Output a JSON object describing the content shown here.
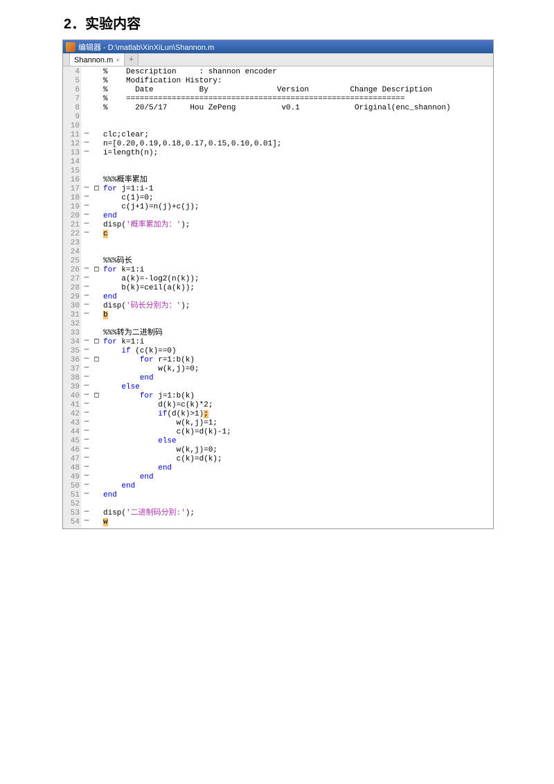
{
  "heading": "2．实验内容",
  "titlebar": "编辑器 - D:\\matlab\\XinXiLun\\Shannon.m",
  "tab": {
    "label": "Shannon.m",
    "close": "×",
    "plus": "+"
  },
  "rows": [
    {
      "n": "4",
      "d": "",
      "f": "",
      "code": "%    Description     : shannon encoder",
      "cls": "c-comment"
    },
    {
      "n": "5",
      "d": "",
      "f": "",
      "code": "%    Modification History:",
      "cls": "c-comment"
    },
    {
      "n": "6",
      "d": "",
      "f": "",
      "code": "%      Date          By               Version         Change Description",
      "cls": "c-comment"
    },
    {
      "n": "7",
      "d": "",
      "f": "",
      "code": "%    =============================================================",
      "cls": "c-comment"
    },
    {
      "n": "8",
      "d": "",
      "f": "",
      "code": "%      20/5/17     Hou ZePeng          v0.1            Original(enc_shannon)",
      "cls": "c-comment"
    },
    {
      "n": "9",
      "d": "",
      "f": "",
      "code": ""
    },
    {
      "n": "10",
      "d": "",
      "f": "",
      "code": ""
    },
    {
      "n": "11",
      "d": "—",
      "f": "",
      "code": "clc;clear;"
    },
    {
      "n": "12",
      "d": "—",
      "f": "",
      "code": "n=[0.20,0.19,0.18,0.17,0.15,0.10,0.01];"
    },
    {
      "n": "13",
      "d": "—",
      "f": "",
      "code": "i=length(n);"
    },
    {
      "n": "14",
      "d": "",
      "f": "",
      "code": ""
    },
    {
      "n": "15",
      "d": "",
      "f": "",
      "code": ""
    },
    {
      "n": "16",
      "d": "",
      "f": "",
      "code": "%%%概率累加",
      "cls": "c-comment"
    },
    {
      "n": "17",
      "d": "—",
      "f": "-",
      "segs": [
        {
          "t": "for ",
          "c": "c-key"
        },
        {
          "t": "j=1:i-1"
        }
      ]
    },
    {
      "n": "18",
      "d": "—",
      "f": "",
      "code": "    c(1)=0;"
    },
    {
      "n": "19",
      "d": "—",
      "f": "",
      "code": "    c(j+1)=n(j)+c(j);"
    },
    {
      "n": "20",
      "d": "—",
      "f": "",
      "segs": [
        {
          "t": "end",
          "c": "c-key"
        }
      ]
    },
    {
      "n": "21",
      "d": "—",
      "f": "",
      "segs": [
        {
          "t": "disp("
        },
        {
          "t": "'概率累加为：'",
          "c": "c-str"
        },
        {
          "t": ");"
        }
      ]
    },
    {
      "n": "22",
      "d": "—",
      "f": "",
      "segs": [
        {
          "t": "c",
          "c": "hl"
        }
      ]
    },
    {
      "n": "23",
      "d": "",
      "f": "",
      "code": ""
    },
    {
      "n": "24",
      "d": "",
      "f": "",
      "code": ""
    },
    {
      "n": "25",
      "d": "",
      "f": "",
      "code": "%%%码长",
      "cls": "c-comment"
    },
    {
      "n": "26",
      "d": "—",
      "f": "-",
      "segs": [
        {
          "t": "for ",
          "c": "c-key"
        },
        {
          "t": "k=1:i"
        }
      ]
    },
    {
      "n": "27",
      "d": "—",
      "f": "",
      "code": "    a(k)=-log2(n(k));"
    },
    {
      "n": "28",
      "d": "—",
      "f": "",
      "code": "    b(k)=ceil(a(k));"
    },
    {
      "n": "29",
      "d": "—",
      "f": "",
      "segs": [
        {
          "t": "end",
          "c": "c-key"
        }
      ]
    },
    {
      "n": "30",
      "d": "—",
      "f": "",
      "segs": [
        {
          "t": "disp("
        },
        {
          "t": "'码长分别为：'",
          "c": "c-str"
        },
        {
          "t": ");"
        }
      ]
    },
    {
      "n": "31",
      "d": "—",
      "f": "",
      "segs": [
        {
          "t": "b",
          "c": "hl"
        }
      ]
    },
    {
      "n": "32",
      "d": "",
      "f": "",
      "code": ""
    },
    {
      "n": "33",
      "d": "",
      "f": "",
      "code": "%%%转为二进制码",
      "cls": "c-comment"
    },
    {
      "n": "34",
      "d": "—",
      "f": "-",
      "segs": [
        {
          "t": "for ",
          "c": "c-key"
        },
        {
          "t": "k=1:i"
        }
      ]
    },
    {
      "n": "35",
      "d": "—",
      "f": "",
      "segs": [
        {
          "t": "    "
        },
        {
          "t": "if ",
          "c": "c-key"
        },
        {
          "t": "(c(k)==0)"
        }
      ]
    },
    {
      "n": "36",
      "d": "—",
      "f": "-",
      "segs": [
        {
          "t": "        "
        },
        {
          "t": "for ",
          "c": "c-key"
        },
        {
          "t": "r=1:b(k)"
        }
      ]
    },
    {
      "n": "37",
      "d": "—",
      "f": "",
      "code": "            w(k,j)=0;"
    },
    {
      "n": "38",
      "d": "—",
      "f": "",
      "segs": [
        {
          "t": "        "
        },
        {
          "t": "end",
          "c": "c-key"
        }
      ]
    },
    {
      "n": "39",
      "d": "—",
      "f": "",
      "segs": [
        {
          "t": "    "
        },
        {
          "t": "else",
          "c": "c-key"
        }
      ]
    },
    {
      "n": "40",
      "d": "—",
      "f": "-",
      "segs": [
        {
          "t": "        "
        },
        {
          "t": "for ",
          "c": "c-key"
        },
        {
          "t": "j=1:b(k)"
        }
      ]
    },
    {
      "n": "41",
      "d": "—",
      "f": "",
      "code": "            d(k)=c(k)*2;"
    },
    {
      "n": "42",
      "d": "—",
      "f": "",
      "segs": [
        {
          "t": "            "
        },
        {
          "t": "if",
          "c": "c-key"
        },
        {
          "t": "(d(k)>1)"
        },
        {
          "t": ";",
          "c": "hl"
        }
      ]
    },
    {
      "n": "43",
      "d": "—",
      "f": "",
      "code": "                w(k,j)=1;"
    },
    {
      "n": "44",
      "d": "—",
      "f": "",
      "code": "                c(k)=d(k)-1;"
    },
    {
      "n": "45",
      "d": "—",
      "f": "",
      "segs": [
        {
          "t": "            "
        },
        {
          "t": "else",
          "c": "c-key"
        }
      ]
    },
    {
      "n": "46",
      "d": "—",
      "f": "",
      "code": "                w(k,j)=0;"
    },
    {
      "n": "47",
      "d": "—",
      "f": "",
      "code": "                c(k)=d(k);"
    },
    {
      "n": "48",
      "d": "—",
      "f": "",
      "segs": [
        {
          "t": "            "
        },
        {
          "t": "end",
          "c": "c-key"
        }
      ]
    },
    {
      "n": "49",
      "d": "—",
      "f": "",
      "segs": [
        {
          "t": "        "
        },
        {
          "t": "end",
          "c": "c-key"
        }
      ]
    },
    {
      "n": "50",
      "d": "—",
      "f": "",
      "segs": [
        {
          "t": "    "
        },
        {
          "t": "end",
          "c": "c-key"
        }
      ]
    },
    {
      "n": "51",
      "d": "—",
      "f": "",
      "segs": [
        {
          "t": "end",
          "c": "c-key"
        }
      ]
    },
    {
      "n": "52",
      "d": "",
      "f": "",
      "code": ""
    },
    {
      "n": "53",
      "d": "—",
      "f": "",
      "segs": [
        {
          "t": "disp("
        },
        {
          "t": "'二进制码分别:'",
          "c": "c-str"
        },
        {
          "t": ");"
        }
      ]
    },
    {
      "n": "54",
      "d": "—",
      "f": "",
      "segs": [
        {
          "t": "w",
          "c": "hl"
        }
      ]
    }
  ]
}
